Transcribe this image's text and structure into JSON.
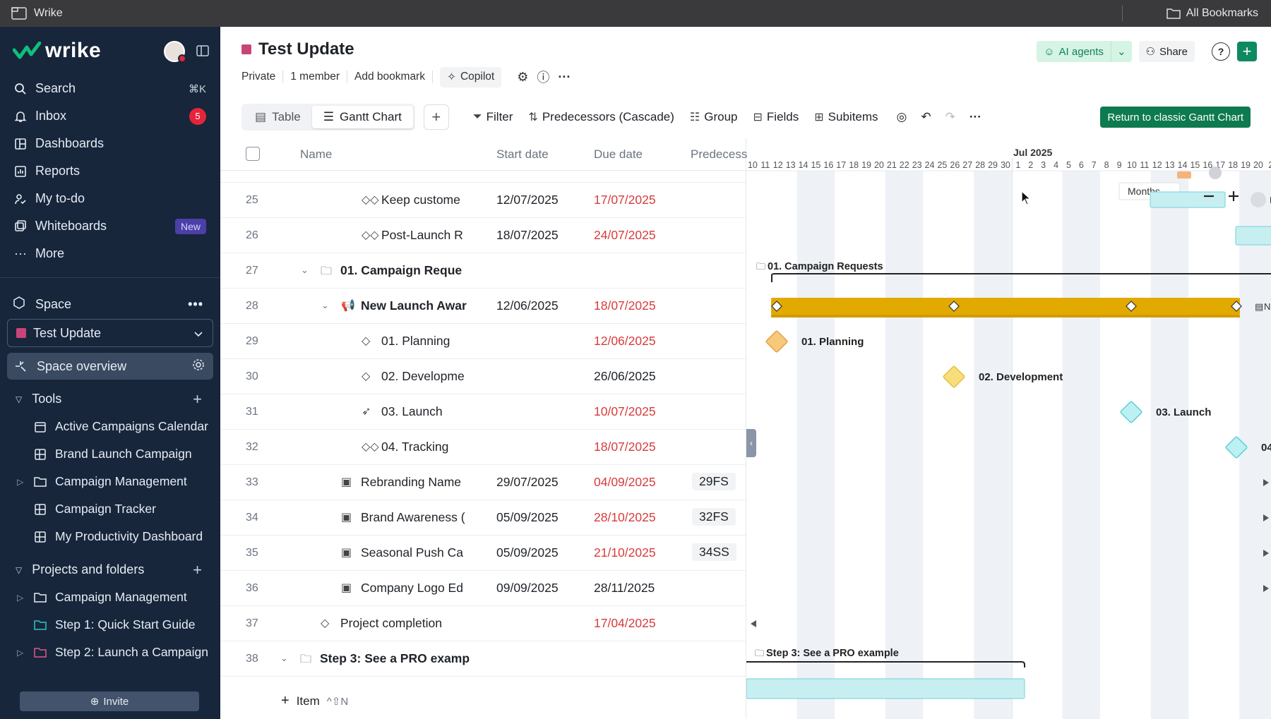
{
  "os": {
    "app_title": "Wrike",
    "bookmarks_label": "All Bookmarks"
  },
  "sidebar": {
    "logo": "wrike",
    "nav": [
      {
        "label": "Search",
        "icon": "search-icon",
        "shortcut": "⌘K"
      },
      {
        "label": "Inbox",
        "icon": "bell-icon",
        "badge": "5"
      },
      {
        "label": "Dashboards",
        "icon": "dashboard-icon"
      },
      {
        "label": "Reports",
        "icon": "reports-icon"
      },
      {
        "label": "My to-do",
        "icon": "todo-icon"
      },
      {
        "label": "Whiteboards",
        "icon": "whiteboard-icon",
        "tag": "New"
      },
      {
        "label": "More",
        "icon": "more-icon"
      }
    ],
    "space_label": "Space",
    "space_select": "Test Update",
    "space_overview": "Space overview",
    "tools_label": "Tools",
    "tools": [
      {
        "label": "Active Campaigns Calendar",
        "icon": "calendar-icon"
      },
      {
        "label": "Brand Launch Campaign",
        "icon": "table-icon"
      },
      {
        "label": "Campaign Management",
        "icon": "folder-icon",
        "expandable": true
      },
      {
        "label": "Campaign Tracker",
        "icon": "table-icon"
      },
      {
        "label": "My Productivity Dashboard",
        "icon": "table-icon"
      }
    ],
    "projects_label": "Projects and folders",
    "projects": [
      {
        "label": "Campaign Management",
        "icon": "folder-icon",
        "expandable": true
      },
      {
        "label": "Step 1: Quick Start Guide",
        "icon": "folder-icon"
      },
      {
        "label": "Step 2: Launch a Campaign",
        "icon": "folder-icon",
        "expandable": true
      }
    ],
    "invite_label": "Invite"
  },
  "header": {
    "title": "Test Update",
    "meta": [
      "Private",
      "1 member",
      "Add bookmark"
    ],
    "copilot": "Copilot",
    "ai_agents": "AI agents",
    "share": "Share",
    "help": "?"
  },
  "toolbar": {
    "tabs": [
      "Table",
      "Gantt Chart"
    ],
    "active_tab": "Gantt Chart",
    "filter": "Filter",
    "predecessors": "Predecessors (Cascade)",
    "group": "Group",
    "fields": "Fields",
    "subitems": "Subitems",
    "classic": "Return to classic Gantt Chart"
  },
  "columns": {
    "name": "Name",
    "start": "Start date",
    "due": "Due date",
    "pred": "Predecess"
  },
  "rows": [
    {
      "num": "25",
      "icon": "milestone-group-icon",
      "name": "Keep custome",
      "start": "12/07/2025",
      "due": "17/07/2025",
      "due_overdue": true,
      "indent": 3
    },
    {
      "num": "26",
      "icon": "milestone-group-icon",
      "name": "Post-Launch R",
      "start": "18/07/2025",
      "due": "24/07/2025",
      "due_overdue": true,
      "indent": 3
    },
    {
      "num": "27",
      "icon": "folder-icon",
      "name": "01. Campaign Reque",
      "start": "",
      "due": "",
      "bold": true,
      "indent": 1,
      "expanded": true
    },
    {
      "num": "28",
      "icon": "megaphone-icon",
      "name": "New Launch Awar",
      "start": "12/06/2025",
      "due": "18/07/2025",
      "due_overdue": true,
      "bold": true,
      "indent": 2,
      "expanded": true
    },
    {
      "num": "29",
      "icon": "milestone-icon",
      "name": "01. Planning",
      "start": "",
      "due": "12/06/2025",
      "due_overdue": true,
      "indent": 3
    },
    {
      "num": "30",
      "icon": "milestone-icon",
      "name": "02. Developme",
      "start": "",
      "due": "26/06/2025",
      "due_overdue": false,
      "indent": 3
    },
    {
      "num": "31",
      "icon": "rocket-icon",
      "name": "03. Launch",
      "start": "",
      "due": "10/07/2025",
      "due_overdue": true,
      "indent": 3
    },
    {
      "num": "32",
      "icon": "milestone-group-icon",
      "name": "04. Tracking",
      "start": "",
      "due": "18/07/2025",
      "due_overdue": true,
      "indent": 3
    },
    {
      "num": "33",
      "icon": "briefcase-icon",
      "name": "Rebranding Name",
      "start": "29/07/2025",
      "due": "04/09/2025",
      "due_overdue": true,
      "pred": "29FS",
      "indent": 2
    },
    {
      "num": "34",
      "icon": "briefcase-icon",
      "name": "Brand Awareness (",
      "start": "05/09/2025",
      "due": "28/10/2025",
      "due_overdue": true,
      "pred": "32FS",
      "indent": 2
    },
    {
      "num": "35",
      "icon": "briefcase-icon",
      "name": "Seasonal Push Ca",
      "start": "05/09/2025",
      "due": "21/10/2025",
      "due_overdue": true,
      "pred": "34SS",
      "indent": 2
    },
    {
      "num": "36",
      "icon": "briefcase-icon",
      "name": "Company Logo Ed",
      "start": "09/09/2025",
      "due": "28/11/2025",
      "due_overdue": false,
      "indent": 2
    },
    {
      "num": "37",
      "icon": "milestone-icon",
      "name": "Project completion",
      "start": "",
      "due": "17/04/2025",
      "due_overdue": true,
      "indent": 1
    },
    {
      "num": "38",
      "icon": "folder-icon",
      "name": "Step 3: See a PRO examp",
      "start": "",
      "due": "",
      "bold": true,
      "indent": 0,
      "expanded": true
    }
  ],
  "add_item": {
    "label": "Item",
    "shortcut": "^⇧N"
  },
  "gantt": {
    "month_label": "Jul 2025",
    "days": [
      "10",
      "11",
      "12",
      "13",
      "14",
      "15",
      "16",
      "17",
      "18",
      "19",
      "20",
      "21",
      "22",
      "23",
      "24",
      "25",
      "26",
      "27",
      "28",
      "29",
      "30",
      "1",
      "2",
      "3",
      "4",
      "5",
      "6",
      "7",
      "8",
      "9",
      "10",
      "11",
      "12",
      "13",
      "14",
      "15",
      "16",
      "17",
      "18",
      "19",
      "20",
      "2"
    ],
    "zoom": "Months",
    "labels": {
      "campaign_requests": "01. Campaign Requests",
      "planning": "01. Planning",
      "development": "02. Development",
      "launch": "03. Launch",
      "tracking": "04",
      "step3": "Step 3: See a PRO example",
      "cut_n": "N",
      "cut_h": "H"
    },
    "colors": {
      "bar": "#e2a900",
      "teal": "#9be3e6",
      "brand": "#0e8a5f",
      "overdue": "#d83b3b"
    }
  }
}
